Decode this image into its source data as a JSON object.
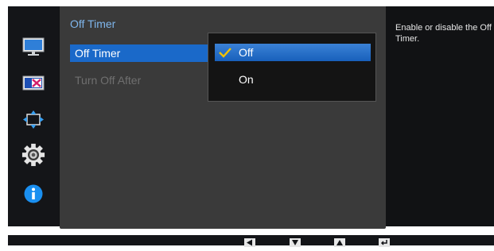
{
  "menu": {
    "title": "Off Timer",
    "items": [
      {
        "label": "Off Timer"
      },
      {
        "label": "Turn Off After"
      }
    ]
  },
  "dropdown": {
    "options": [
      {
        "label": "Off",
        "checked": true
      },
      {
        "label": "On",
        "checked": false
      }
    ]
  },
  "help": {
    "text": "Enable or disable the Off Timer."
  },
  "sidebar": {
    "icons": [
      "monitor-icon",
      "color-icon",
      "screen-size-icon",
      "settings-gear-icon",
      "info-icon"
    ]
  },
  "guide": {
    "icons": [
      "left-arrow-icon",
      "down-arrow-icon",
      "up-arrow-icon",
      "enter-icon"
    ]
  },
  "colors": {
    "accent": "#1a69c9",
    "title": "#7fb6ec",
    "check": "#f2c200"
  }
}
